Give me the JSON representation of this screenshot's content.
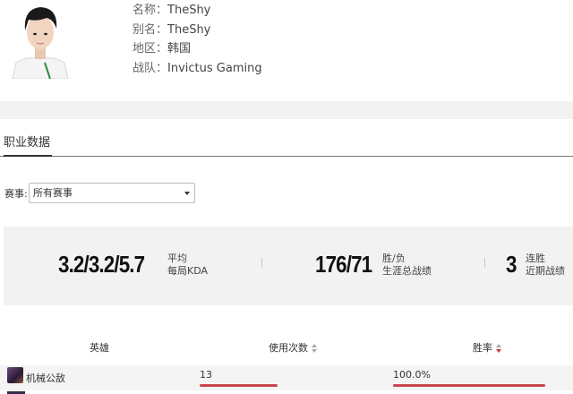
{
  "profile": {
    "rows": [
      {
        "label": "名称：",
        "value": "TheShy"
      },
      {
        "label": "别名：",
        "value": "TheShy"
      },
      {
        "label": "地区：",
        "value": "韩国"
      },
      {
        "label": "战队：",
        "value": "Invictus Gaming"
      }
    ]
  },
  "tabs": {
    "active": "职业数据"
  },
  "filter": {
    "label": "赛事:",
    "selected": "所有赛事"
  },
  "stats": {
    "kda_value": "3.2/3.2/5.7",
    "kda_line1": "平均",
    "kda_line2": "每局KDA",
    "record_value": "176/71",
    "record_line1": "胜/负",
    "record_line2": "生涯总战绩",
    "streak_value": "3",
    "streak_line1": "连胜",
    "streak_line2": "近期战绩"
  },
  "table": {
    "headers": {
      "hero": "英雄",
      "uses": "使用次数",
      "winrate": "胜率"
    },
    "rows": [
      {
        "hero": "机械公敌",
        "uses": "13",
        "winrate": "100.0%",
        "uses_bar_fill": 1.0,
        "winrate_bar_fill": 1.0
      }
    ]
  },
  "colors": {
    "accent_bar": "#c9464c",
    "sort_active": "#d0343c",
    "panel_bg": "#f2f2f2"
  },
  "icons": {
    "avatar": "player-avatar",
    "dropdown": "chevron-down-icon",
    "sort": "sort-icon"
  }
}
